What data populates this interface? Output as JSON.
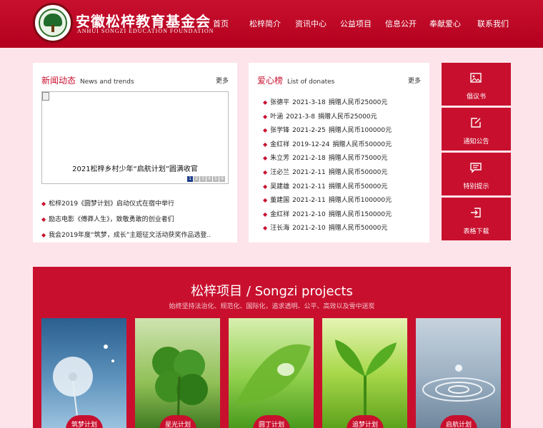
{
  "header": {
    "logo_cn": "安徽松梓教育基金会",
    "logo_en": "ANHUI SONGZI EDUCATION FOUNDATION",
    "nav": [
      "首页",
      "松梓简介",
      "资讯中心",
      "公益项目",
      "信息公开",
      "奉献爱心",
      "联系我们"
    ]
  },
  "news": {
    "title_cn": "新闻动态",
    "title_en": "News and trends",
    "more": "更多",
    "slider_caption": "2021松梓乡村少年“启航计划”圆满收官",
    "slider_pages": [
      "1",
      "2",
      "3",
      "4",
      "5",
      "6"
    ],
    "items": [
      "松梓2019《圆梦计划》启动仪式在宿中举行",
      "励志电影《傅莽人生》，致敬勇敢的创业者们",
      "我会2019年度“筑梦，成长”主题征文活动获奖作品选登.."
    ]
  },
  "donate": {
    "title_cn": "爱心榜",
    "title_en": "List of donates",
    "more": "更多",
    "items": [
      {
        "name": "张德平",
        "date": "2021-3-18",
        "amount": "捐赠人民币25000元"
      },
      {
        "name": "叶涵",
        "date": "2021-3-8",
        "amount": "捐赠人民币25000元"
      },
      {
        "name": "张学锋",
        "date": "2021-2-25",
        "amount": "捐赠人民币100000元"
      },
      {
        "name": "金红祥",
        "date": "2019-12-24",
        "amount": "捐赠人民币50000元"
      },
      {
        "name": "朱立芳",
        "date": "2021-2-18",
        "amount": "捐赠人民币75000元"
      },
      {
        "name": "汪必兰",
        "date": "2021-2-11",
        "amount": "捐赠人民币50000元"
      },
      {
        "name": "吴建雄",
        "date": "2021-2-11",
        "amount": "捐赠人民币50000元"
      },
      {
        "name": "董建国",
        "date": "2021-2-11",
        "amount": "捐赠人民币100000元"
      },
      {
        "name": "金红祥",
        "date": "2021-2-10",
        "amount": "捐赠人民币150000元"
      },
      {
        "name": "汪长海",
        "date": "2021-2-10",
        "amount": "捐赠人民币50000元"
      }
    ]
  },
  "side_buttons": [
    {
      "label": "倡议书",
      "icon": "image-icon"
    },
    {
      "label": "通知公告",
      "icon": "notice-edit-icon"
    },
    {
      "label": "特别提示",
      "icon": "chat-bubble-icon"
    },
    {
      "label": "表格下载",
      "icon": "download-arrow-icon"
    }
  ],
  "projects": {
    "title": "松梓项目 / Songzi projects",
    "subtitle": "始终坚持法治化、规范化、国际化，追求透明、公平、高效以及雪中送炭",
    "cards": [
      {
        "label": "筑梦计划",
        "bg": "#3a6d9a"
      },
      {
        "label": "星光计划",
        "bg": "#4f8a2d"
      },
      {
        "label": "圆丁计划",
        "bg": "#7ab33a"
      },
      {
        "label": "追梦计划",
        "bg": "#86c23e"
      },
      {
        "label": "启航计划",
        "bg": "#8aa0b4"
      }
    ]
  },
  "colors": {
    "brand_red": "#c8102e",
    "page_bg": "#fde4ea"
  }
}
